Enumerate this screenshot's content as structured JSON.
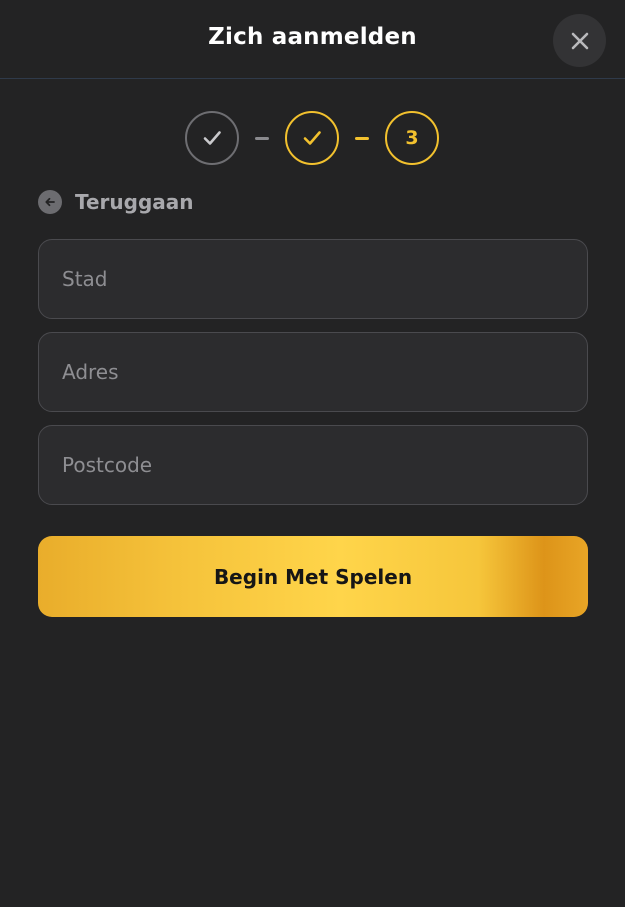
{
  "header": {
    "title": "Zich aanmelden",
    "close_icon": "close-icon"
  },
  "stepper": {
    "steps": [
      {
        "state": "done",
        "icon": "check-icon"
      },
      {
        "state": "done-active",
        "icon": "check-icon"
      },
      {
        "state": "current",
        "label": "3"
      }
    ]
  },
  "back": {
    "label": "Teruggaan",
    "icon": "arrow-left-icon"
  },
  "form": {
    "city_placeholder": "Stad",
    "city_value": "",
    "address_placeholder": "Adres",
    "address_value": "",
    "postcode_placeholder": "Postcode",
    "postcode_value": ""
  },
  "cta": {
    "label": "Begin Met Spelen"
  },
  "colors": {
    "background": "#232324",
    "accent": "#f2c12e",
    "field_bg": "#2c2c2e",
    "field_border": "#4a4a4e"
  }
}
